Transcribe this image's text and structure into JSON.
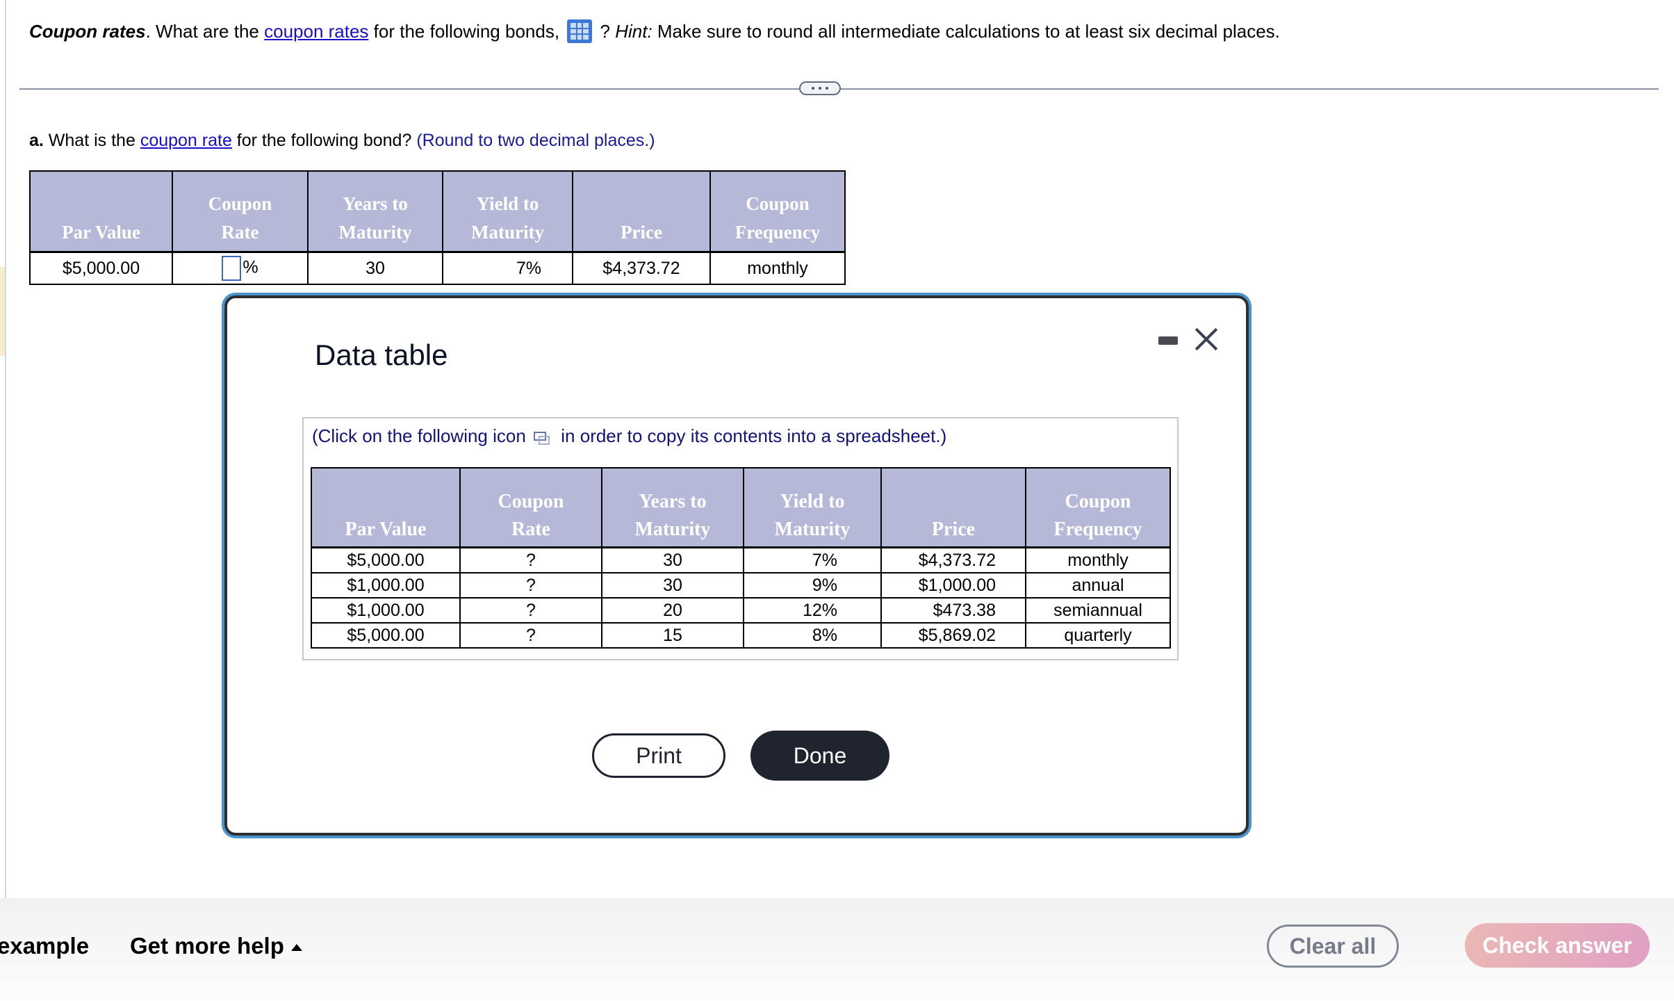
{
  "question": {
    "title": "Coupon rates",
    "text_1": ". What are the ",
    "link": "coupon rates",
    "text_2": " for the following bonds, ",
    "text_3": " ? ",
    "hint_label": "Hint:",
    "hint_text": " Make sure to round all intermediate calculations to at least six decimal places."
  },
  "part_a": {
    "label": "a.",
    "text_1": " What is the ",
    "link": "coupon rate",
    "text_2": " for the following bond?  ",
    "instruction": "(Round to two decimal places.)"
  },
  "main_table": {
    "headers": [
      [
        "",
        "Par Value"
      ],
      [
        "Coupon",
        "Rate"
      ],
      [
        "Years to",
        "Maturity"
      ],
      [
        "Yield to",
        "Maturity"
      ],
      [
        "",
        "Price"
      ],
      [
        "Coupon",
        "Frequency"
      ]
    ],
    "row": {
      "par_value": "$5,000.00",
      "coupon_rate_value": "",
      "coupon_rate_unit": "%",
      "years": "30",
      "ytm": "7%",
      "price": "$4,373.72",
      "frequency": "monthly"
    }
  },
  "modal": {
    "title": "Data table",
    "copy_note_1": "(Click on the following icon ",
    "copy_note_2": " in order to copy its contents into a spreadsheet.)",
    "table": {
      "headers": [
        [
          "",
          "Par Value"
        ],
        [
          "Coupon",
          "Rate"
        ],
        [
          "Years to",
          "Maturity"
        ],
        [
          "Yield to",
          "Maturity"
        ],
        [
          "",
          "Price"
        ],
        [
          "Coupon",
          "Frequency"
        ]
      ],
      "rows": [
        [
          "$5,000.00",
          "?",
          "30",
          "7%",
          "$4,373.72",
          "monthly"
        ],
        [
          "$1,000.00",
          "?",
          "30",
          "9%",
          "$1,000.00",
          "annual"
        ],
        [
          "$1,000.00",
          "?",
          "20",
          "12%",
          "$473.38",
          "semiannual"
        ],
        [
          "$5,000.00",
          "?",
          "15",
          "8%",
          "$5,869.02",
          "quarterly"
        ]
      ]
    },
    "print_label": "Print",
    "done_label": "Done"
  },
  "footer": {
    "example_label": "example",
    "help_label": "Get more help",
    "clear_label": "Clear all",
    "check_label": "Check answer"
  },
  "colors": {
    "header_bg": "#b6b8d8",
    "link": "#1a0dcc",
    "modal_outline": "#4a94cb",
    "done_bg": "#20242f",
    "check_gradient": [
      "#ebb8b4",
      "#e0a0c4"
    ]
  }
}
